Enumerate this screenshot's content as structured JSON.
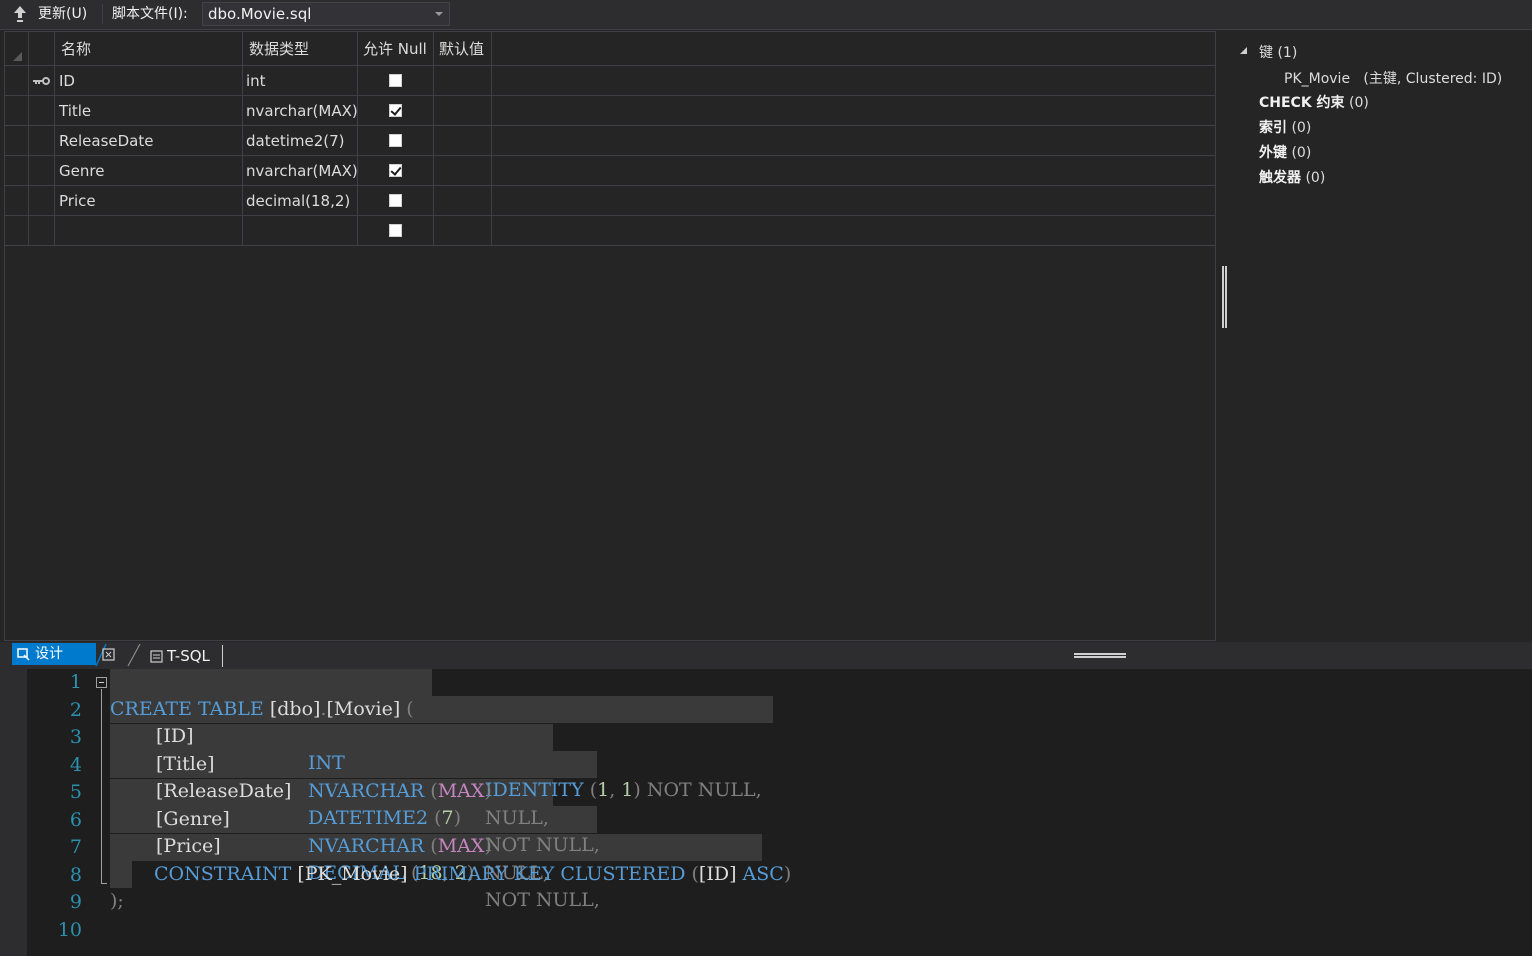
{
  "toolbar": {
    "update_label": "更新(U)",
    "script_file_label": "脚本文件(I):",
    "script_file_value": "dbo.Movie.sql"
  },
  "grid": {
    "headers": {
      "name": "名称",
      "type": "数据类型",
      "allow_null": "允许 Null",
      "default": "默认值"
    },
    "rows": [
      {
        "name": "ID",
        "type": "int",
        "allow_null": false,
        "is_key": true
      },
      {
        "name": "Title",
        "type": "nvarchar(MAX)",
        "allow_null": true,
        "is_key": false
      },
      {
        "name": "ReleaseDate",
        "type": "datetime2(7)",
        "allow_null": false,
        "is_key": false
      },
      {
        "name": "Genre",
        "type": "nvarchar(MAX)",
        "allow_null": true,
        "is_key": false
      },
      {
        "name": "Price",
        "type": "decimal(18,2)",
        "allow_null": false,
        "is_key": false
      },
      {
        "name": "",
        "type": "",
        "allow_null": false,
        "is_key": false
      }
    ]
  },
  "properties": {
    "keys": "键 (1)",
    "pk_name": "PK_Movie",
    "pk_detail": "(主键, Clustered: ID)",
    "check_bold": "CHECK 约束",
    "check_count": "(0)",
    "index_bold": "索引",
    "index_count": "(0)",
    "fk_bold": "外键",
    "fk_count": "(0)",
    "trigger_bold": "触发器",
    "trigger_count": "(0)"
  },
  "tabs": {
    "design": "设计",
    "tsql": "T-SQL"
  },
  "code": {
    "line_numbers": [
      "1",
      "2",
      "3",
      "4",
      "5",
      "6",
      "7",
      "8",
      "9",
      "10"
    ],
    "l1": {
      "create": "CREATE TABLE",
      "obj": "[dbo]",
      "dot": ".",
      "tbl": "[Movie]",
      "paren": "("
    },
    "l2": {
      "col": "[ID]",
      "type": "INT",
      "ident": "IDENTITY",
      "p1": "(",
      "n1": "1",
      "comma": ",",
      "n2": "1",
      "p2": ")",
      "null": "NOT NULL,"
    },
    "l3": {
      "col": "[Title]",
      "type": "NVARCHAR",
      "p1": "(",
      "max": "MAX",
      "p2": ")",
      "null": "NULL,"
    },
    "l4": {
      "col": "[ReleaseDate]",
      "type": "DATETIME2",
      "p1": "(",
      "n": "7",
      "p2": ")",
      "null": "NOT NULL,"
    },
    "l5": {
      "col": "[Genre]",
      "type": "NVARCHAR",
      "p1": "(",
      "max": "MAX",
      "p2": ")",
      "null": "NULL,"
    },
    "l6": {
      "col": "[Price]",
      "type": "DECIMAL",
      "p1": "(",
      "n1": "18",
      "comma": ",",
      "n2": "2",
      "p2": ")",
      "null": "NOT NULL,"
    },
    "l7": {
      "constraint": "CONSTRAINT",
      "pk": "[PK_Movie]",
      "primary": "PRIMARY KEY CLUSTERED",
      "p1": "(",
      "col": "[ID]",
      "asc": "ASC",
      "p2": ")"
    },
    "l8": {
      "end": ");"
    }
  }
}
